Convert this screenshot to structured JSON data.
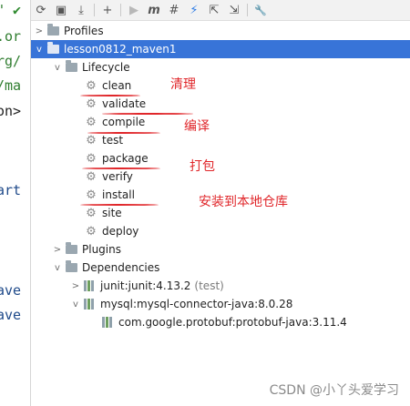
{
  "editor": {
    "lines": [
      {
        "text": "\"",
        "color": "#2f7d2f"
      },
      {
        "text": ".or",
        "color": "#2f7d2f"
      },
      {
        "text": "rg/",
        "color": "#2f7d2f"
      },
      {
        "text": "/ma",
        "color": "#2f7d2f"
      },
      {
        "text": "on>",
        "color": "#1f1f1f"
      },
      {
        "text": "art",
        "color": "#1f4a8a"
      },
      {
        "text": "ave",
        "color": "#1f4a8a"
      },
      {
        "text": "ave",
        "color": "#1f4a8a"
      }
    ]
  },
  "toolbar": {
    "buttons": [
      {
        "icon": "refresh-icon",
        "glyph": "⟳"
      },
      {
        "icon": "add-folder-icon",
        "glyph": "▣"
      },
      {
        "icon": "download-icon",
        "glyph": "⤓"
      },
      {
        "icon": "plus-icon",
        "glyph": "+"
      },
      {
        "icon": "run-icon",
        "glyph": "▶"
      },
      {
        "icon": "maven-goal-icon",
        "glyph": "m"
      },
      {
        "icon": "toggle-offline-icon",
        "glyph": "#"
      },
      {
        "icon": "skip-tests-icon",
        "glyph": "⚡"
      },
      {
        "icon": "expand-all-icon",
        "glyph": "⇱"
      },
      {
        "icon": "collapse-all-icon",
        "glyph": "⇲"
      },
      {
        "icon": "wrench-icon",
        "glyph": "🔧"
      }
    ]
  },
  "tree": {
    "profiles": "Profiles",
    "project": "lesson0812_maven1",
    "lifecycle": "Lifecycle",
    "phases": [
      "clean",
      "validate",
      "compile",
      "test",
      "package",
      "verify",
      "install",
      "site",
      "deploy"
    ],
    "plugins": "Plugins",
    "dependencies": "Dependencies",
    "dep_junit": "junit:junit:4.13.2",
    "dep_junit_scope": "(test)",
    "dep_mysql": "mysql:mysql-connector-java:8.0.28",
    "dep_protobuf": "com.google.protobuf:protobuf-java:3.11.4"
  },
  "annotations": {
    "clean": "清理",
    "compile": "编译",
    "package": "打包",
    "install": "安装到本地仓库"
  },
  "watermark": "CSDN @小丫头爱学习",
  "colors": {
    "selection": "#3874d8",
    "annotation": "#e0262a"
  }
}
